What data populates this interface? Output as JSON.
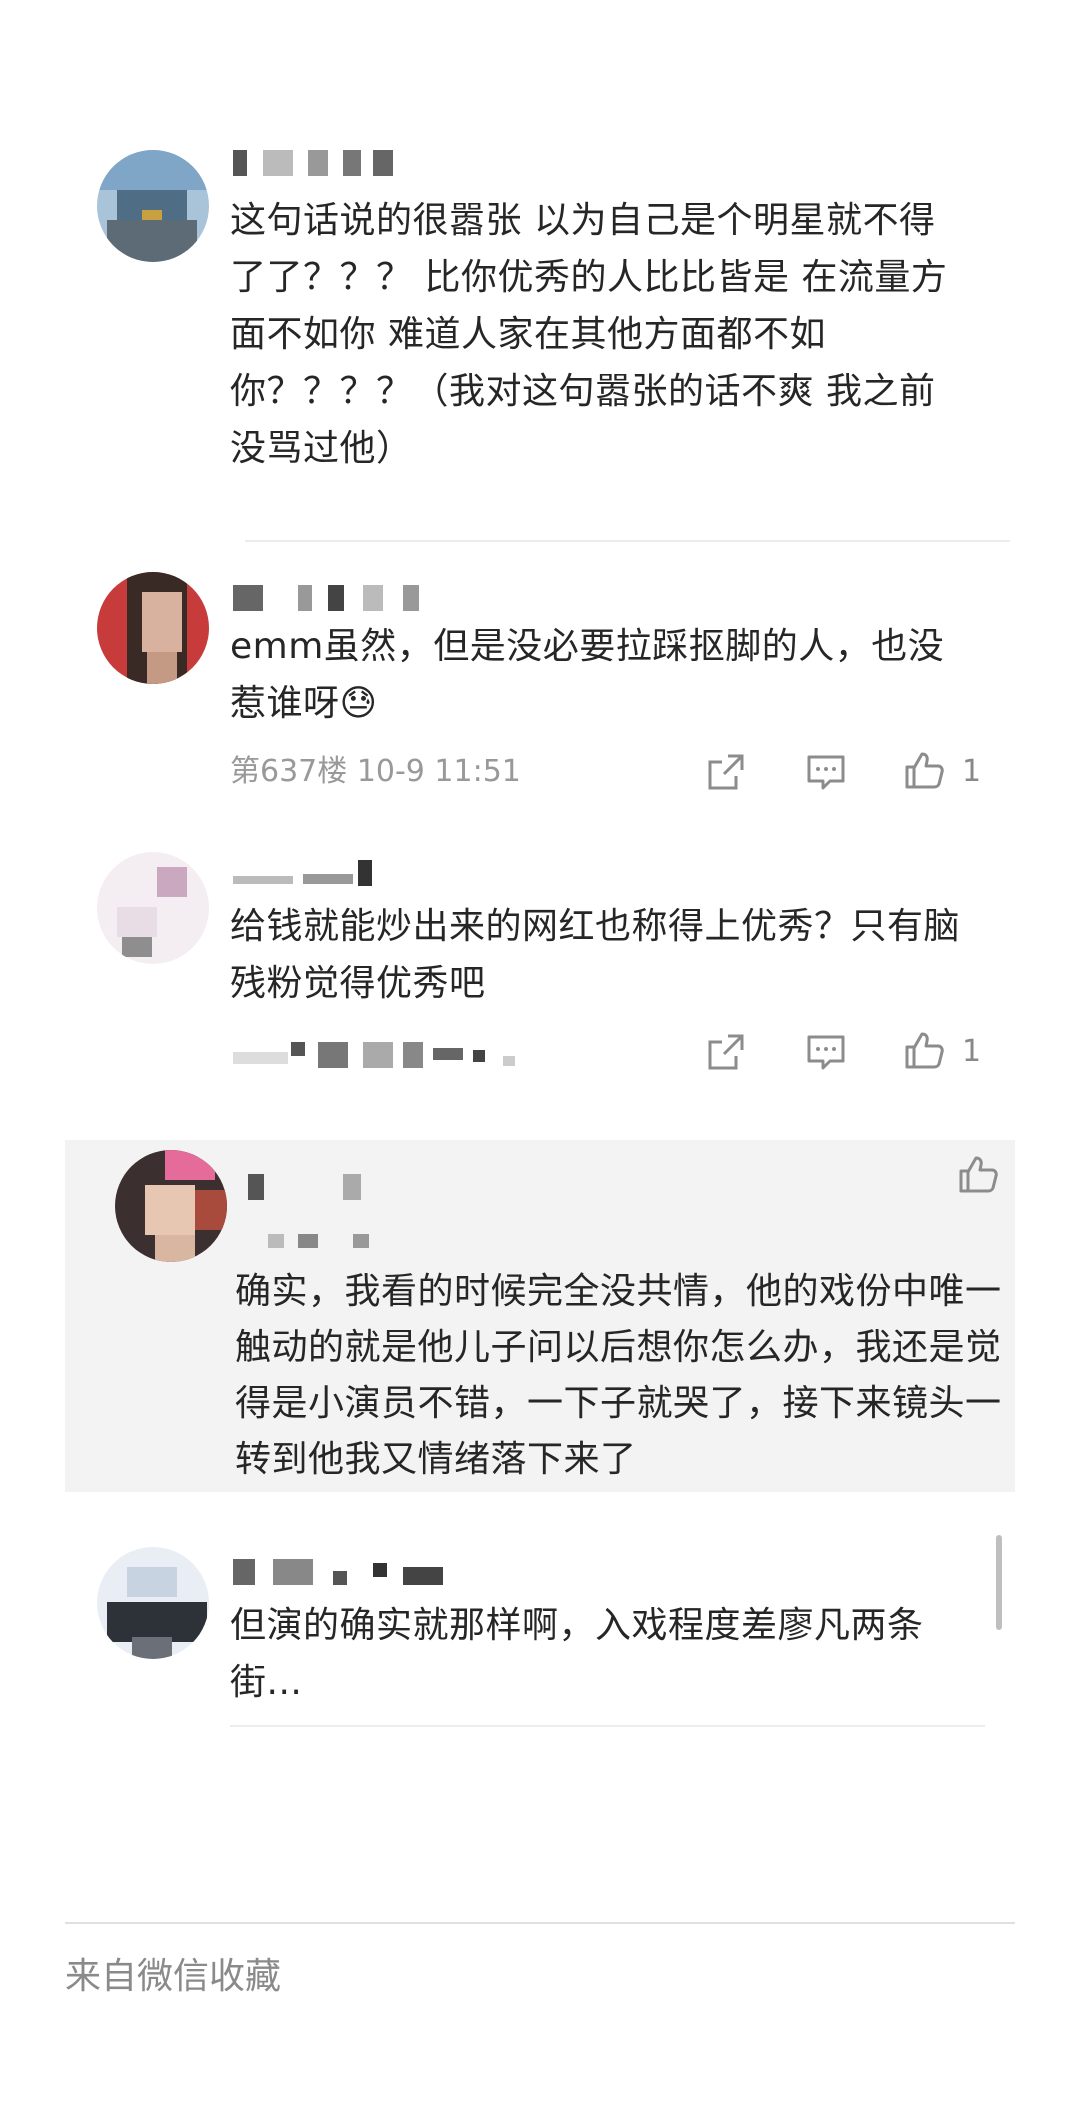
{
  "comments": [
    {
      "text": "这句话说的很嚣张 以为自己是个明星就不得了了？？？ 比你优秀的人比比皆是 在流量方面不如你 难道人家在其他方面都不如你？？？？（我对这句嚣张的话不爽 我之前没骂过他）"
    },
    {
      "text": "emm虽然，但是没必要拉踩抠脚的人，也没惹谁呀😓",
      "floor": "第637楼",
      "time": "10-9 11:51",
      "likes": "1"
    },
    {
      "text": "给钱就能炒出来的网红也称得上优秀？只有脑残粉觉得优秀吧",
      "likes": "1"
    }
  ],
  "quoted_reply": {
    "text": "确实，我看的时候完全没共情，他的戏份中唯一触动的就是他儿子问以后想你怎么办，我还是觉得是小演员不错，一下子就哭了，接下来镜头一转到他我又情绪落下来了"
  },
  "last_comment": {
    "text": "但演的确实就那样啊，入戏程度差廖凡两条街..."
  },
  "footer": {
    "source": "来自微信收藏"
  },
  "icons": {
    "share": "share-icon",
    "comment": "comment-icon",
    "like": "thumbs-up-icon"
  },
  "colors": {
    "text": "#262626",
    "meta": "#999999",
    "quote_bg": "#f3f3f3"
  }
}
